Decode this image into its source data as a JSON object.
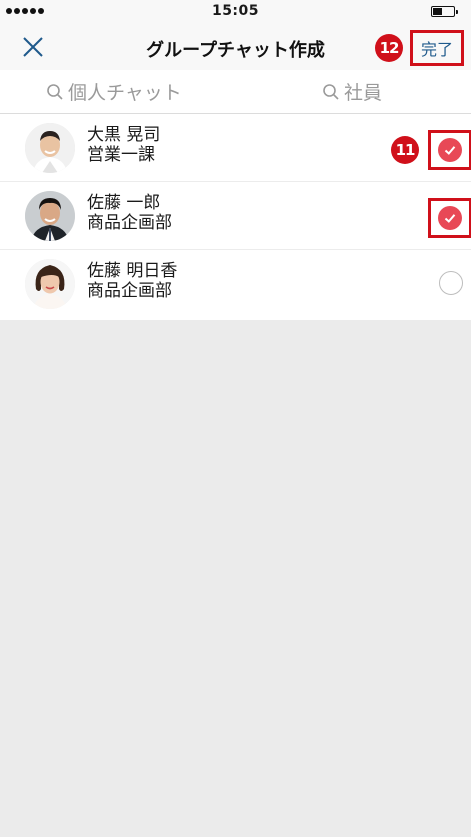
{
  "status_bar": {
    "time": "15:05"
  },
  "nav": {
    "title": "グループチャット作成",
    "done_label": "完了",
    "close_icon": "close-icon"
  },
  "annotations": {
    "badge_done": "12",
    "badge_check": "11"
  },
  "search": {
    "tab_individual": "個人チャット",
    "tab_employee": "社員",
    "icon": "search-icon"
  },
  "members": [
    {
      "name": "大黒 晃司",
      "department": "営業一課",
      "selected": true
    },
    {
      "name": "佐藤 一郎",
      "department": "商品企画部",
      "selected": true
    },
    {
      "name": "佐藤 明日香",
      "department": "商品企画部",
      "selected": false
    }
  ],
  "colors": {
    "accent_red": "#d0101a",
    "check_fill": "#e84856",
    "link_blue": "#1f5a8c",
    "background": "#ebebeb"
  }
}
